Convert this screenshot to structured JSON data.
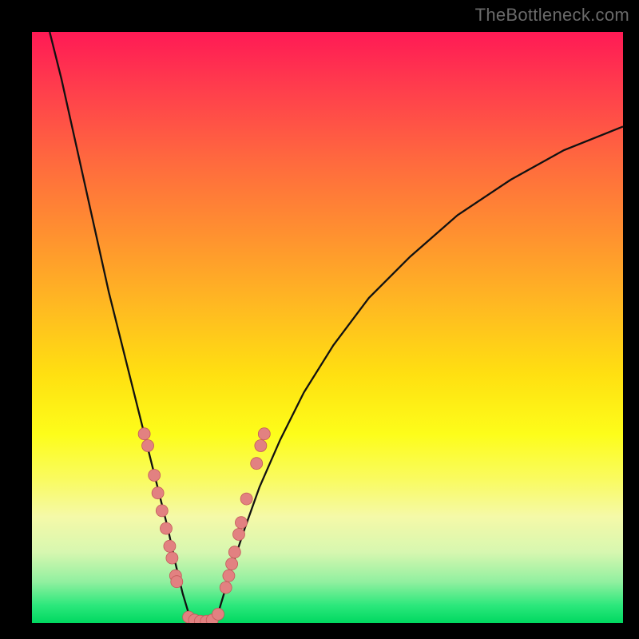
{
  "watermark": "TheBottleneck.com",
  "colors": {
    "frame": "#000000",
    "curve": "#111111",
    "marker_fill": "#e28181",
    "marker_stroke": "#c45a5a",
    "gradient_top": "#ff1a55",
    "gradient_bottom": "#00d860"
  },
  "chart_data": {
    "type": "line",
    "title": "",
    "xlabel": "",
    "ylabel": "",
    "xlim": [
      0,
      100
    ],
    "ylim": [
      0,
      100
    ],
    "series": [
      {
        "name": "bottleneck-curve-left",
        "x": [
          3,
          5,
          7,
          9,
          11,
          13,
          15,
          17,
          18.5,
          20,
          21.5,
          23,
          24.3,
          25.5,
          27
        ],
        "y": [
          100,
          92,
          83,
          74,
          65,
          56,
          48,
          40,
          34,
          28,
          22,
          16,
          10,
          5,
          0
        ]
      },
      {
        "name": "bottleneck-curve-right",
        "x": [
          31,
          32.5,
          34,
          36,
          38.5,
          42,
          46,
          51,
          57,
          64,
          72,
          81,
          90,
          100
        ],
        "y": [
          0,
          5,
          10,
          16,
          23,
          31,
          39,
          47,
          55,
          62,
          69,
          75,
          80,
          84
        ]
      }
    ],
    "markers": [
      {
        "x": 19.0,
        "y": 32
      },
      {
        "x": 19.6,
        "y": 30
      },
      {
        "x": 20.7,
        "y": 25
      },
      {
        "x": 21.3,
        "y": 22
      },
      {
        "x": 22.0,
        "y": 19
      },
      {
        "x": 22.7,
        "y": 16
      },
      {
        "x": 23.3,
        "y": 13
      },
      {
        "x": 23.7,
        "y": 11
      },
      {
        "x": 24.3,
        "y": 8
      },
      {
        "x": 24.5,
        "y": 7
      },
      {
        "x": 26.5,
        "y": 1
      },
      {
        "x": 27.5,
        "y": 0.5
      },
      {
        "x": 28.5,
        "y": 0.3
      },
      {
        "x": 29.5,
        "y": 0.3
      },
      {
        "x": 30.5,
        "y": 0.5
      },
      {
        "x": 31.5,
        "y": 1.5
      },
      {
        "x": 32.8,
        "y": 6
      },
      {
        "x": 33.3,
        "y": 8
      },
      {
        "x": 33.8,
        "y": 10
      },
      {
        "x": 34.3,
        "y": 12
      },
      {
        "x": 35.0,
        "y": 15
      },
      {
        "x": 35.4,
        "y": 17
      },
      {
        "x": 36.3,
        "y": 21
      },
      {
        "x": 38.0,
        "y": 27
      },
      {
        "x": 38.7,
        "y": 30
      },
      {
        "x": 39.3,
        "y": 32
      }
    ]
  }
}
